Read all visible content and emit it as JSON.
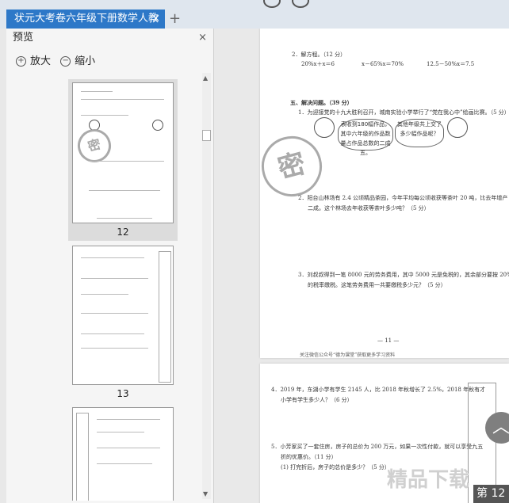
{
  "tab": {
    "title": "状元大考卷六年级下册数学人教",
    "close": "×",
    "new_tab": "+"
  },
  "panel": {
    "title": "预览",
    "close": "×",
    "zoom_in": "放大",
    "zoom_out": "缩小",
    "thumbnails": [
      {
        "number": "12",
        "selected": true
      },
      {
        "number": "13",
        "selected": false
      }
    ]
  },
  "page_top": {
    "item2": "2．解方程。（12 分）",
    "eq1": "20%x＋x＝6",
    "eq2": "x－65%x＝70%",
    "eq3": "12.5－50%x＝7.5",
    "section": "五、解决问题。（39 分）",
    "q1": "1．为迎接党的十九大胜利召开，城南实验小学举行了“党在我心中”绘画比赛。（5 分）",
    "bubble1": "表收到180幅作品，其中六年级的作品数量占作品总数的二成五。",
    "bubble2": "其他年级共上交了多少幅作品呢？",
    "stamp": "密",
    "q2a": "2．阳台山林场有 2.4 公顷精品茶园，今年平均每公顷收获等茶叶 20 吨，比去年增产",
    "q2b": "二成。这个林场去年收获等茶叶多少吨？（5 分）",
    "q3a": "3．刘叔叔得到一笔 8000 元的劳务费用，其中 5000 元是免税的，其余部分要按 20%",
    "q3b": "的税率缴税。这笔劳务费用一共要缴税多少元？（5 分）",
    "page_no": "— 11 —",
    "footer": "关注微信公众号“德为课堂”获取更多学习资料"
  },
  "page_bottom": {
    "q4a": "4．2019 年，东湖小学有学生 2145 人，比 2018 年秋增长了 2.5%，2018 年秋有才",
    "q4b": "小学有学生多少人？（6 分）",
    "q5a": "5．小芳家买了一套住房，房子的总价为 200 万元，如果一次性付款，就可以享受九五",
    "q5b": "折的优惠价。（11 分）",
    "q5c": "(1) 打完折后，房子的总价是多少？（5 分）"
  },
  "page_indicator": "第 12",
  "watermark": "精品下载"
}
